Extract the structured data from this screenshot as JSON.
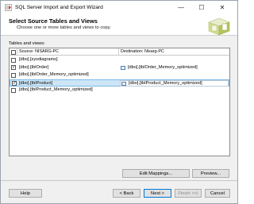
{
  "window": {
    "title": "SQL Server Import and Export Wizard",
    "controls": [
      "—",
      "☐",
      "✕"
    ]
  },
  "header": {
    "title": "Select Source Tables and Views",
    "subtitle": "Choose one or more tables and views to copy."
  },
  "list": {
    "label": "Tables and views:",
    "columns": {
      "source": "Source: NISARG-PC",
      "destination": "Destination: Nisarg-PC"
    },
    "rows": [
      {
        "checked": false,
        "source": "[dbo].[sysdiagrams]",
        "destination": "",
        "selected": false
      },
      {
        "checked": true,
        "source": "[dbo].[tblOrder]",
        "destination": "[dbo].[tblOrder_Memory_optimized]",
        "selected": false
      },
      {
        "checked": false,
        "source": "[dbo].[tblOrder_Memory_optimized]",
        "destination": "",
        "selected": false
      },
      {
        "checked": true,
        "source": "[dbo].[tblProduct]",
        "destination": "[dbo].[tblProduct_Memory_optimized]",
        "selected": true
      },
      {
        "checked": false,
        "source": "[dbo].[tblProduct_Memory_optimized]",
        "destination": "",
        "selected": false
      }
    ]
  },
  "buttons": {
    "edit_mappings": "Edit Mappings...",
    "preview": "Preview...",
    "help": "Help",
    "back": "< Back",
    "next": "Next >",
    "finish": "Finish >>|",
    "cancel": "Cancel"
  },
  "colors": {
    "accent": "#0078d7",
    "selection": "#cde6f7"
  }
}
